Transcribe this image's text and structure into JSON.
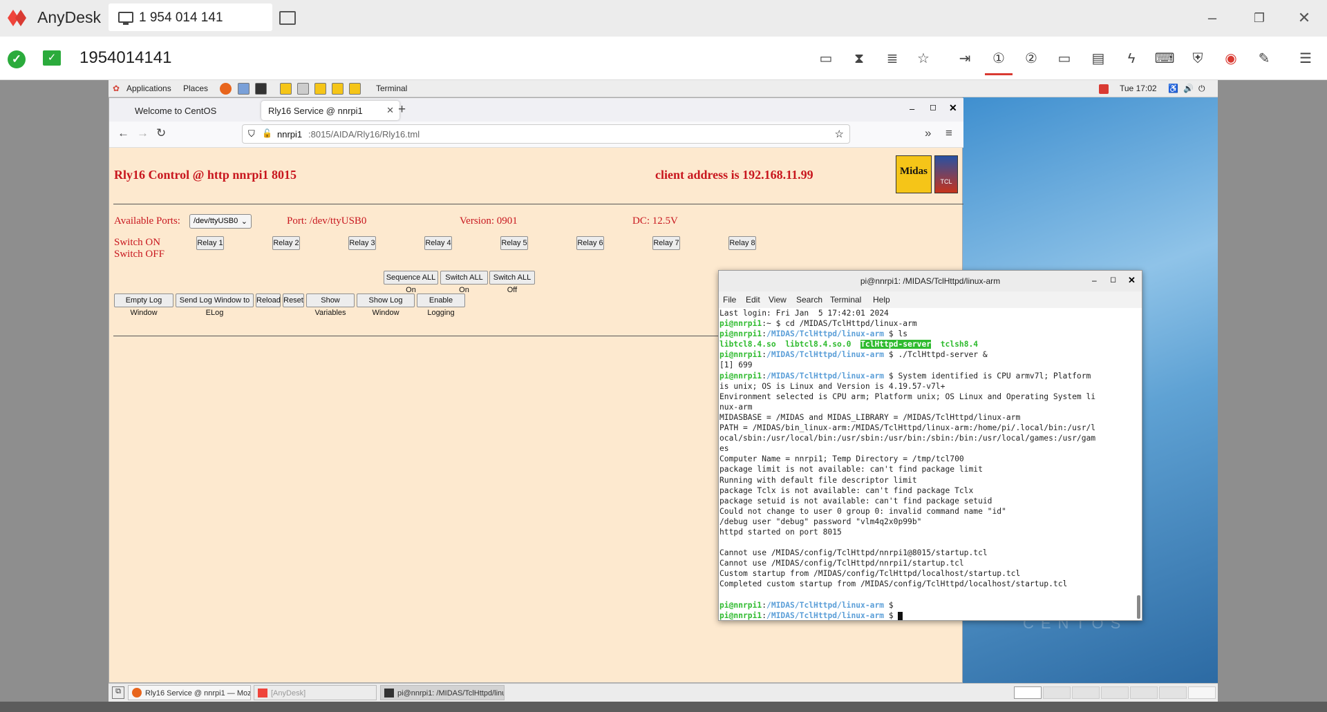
{
  "anydesk": {
    "brand": "AnyDesk",
    "tab_label": "1 954 014 141",
    "remote_id": "1954014141"
  },
  "gnome": {
    "applications": "Applications",
    "places": "Places",
    "terminal": "Terminal",
    "clock": "Tue 17:02"
  },
  "firefox": {
    "tab1": "Welcome to CentOS",
    "tab2": "Rly16 Service @ nnrpi1",
    "url_host": "nnrpi1",
    "url_path": ":8015/AIDA/Rly16/Rly16.tml"
  },
  "page": {
    "title": "Rly16 Control @ http nnrpi1 8015",
    "client": "client address is 192.168.11.99",
    "logo1_text": "Midas",
    "logo2_text": "TCL",
    "available_ports_label": "Available Ports:",
    "port_select": "/dev/ttyUSB0",
    "port": "Port: /dev/ttyUSB0",
    "version": "Version: 0901",
    "dc": "DC: 12.5V",
    "switch_on": "Switch ON",
    "switch_off": "Switch OFF",
    "relays": [
      "Relay 1",
      "Relay 2",
      "Relay 3",
      "Relay 4",
      "Relay 5",
      "Relay 6",
      "Relay 7",
      "Relay 8"
    ],
    "sequence_all_on": "Sequence ALL On",
    "switch_all_on": "Switch ALL On",
    "switch_all_off": "Switch ALL Off",
    "log_buttons": [
      "Empty Log Window",
      "Send Log Window to ELog",
      "Reload",
      "Reset",
      "Show Variables",
      "Show Log Window",
      "Enable Logging"
    ]
  },
  "terminal": {
    "title": "pi@nnrpi1: /MIDAS/TclHttpd/linux-arm",
    "menu": [
      "File",
      "Edit",
      "View",
      "Search",
      "Terminal",
      "Help"
    ],
    "prompt_user": "pi@nnrpi1",
    "prompt_path": "/MIDAS/TclHttpd/linux-arm",
    "line_login": "Last login: Fri Jan  5 17:42:01 2024",
    "cmd_cd": "cd /MIDAS/TclHttpd/linux-arm",
    "cmd_ls": "ls",
    "ls_1": "libtcl8.4.so",
    "ls_2": "libtcl8.4.so.0",
    "ls_3": "TclHttpd-server",
    "ls_4": "tclsh8.4",
    "cmd_run": "./TclHttpd-server &",
    "job": "[1] 699",
    "sys_1": "System identified is CPU armv7l; Platform",
    "out_lines": [
      "is unix; OS is Linux and Version is 4.19.57-v7l+",
      "Environment selected is CPU arm; Platform unix; OS Linux and Operating System li",
      "nux-arm",
      "MIDASBASE = /MIDAS and MIDAS_LIBRARY = /MIDAS/TclHttpd/linux-arm",
      "PATH = /MIDAS/bin_linux-arm:/MIDAS/TclHttpd/linux-arm:/home/pi/.local/bin:/usr/l",
      "ocal/sbin:/usr/local/bin:/usr/sbin:/usr/bin:/sbin:/bin:/usr/local/games:/usr/gam",
      "es",
      "Computer Name = nnrpi1; Temp Directory = /tmp/tcl700",
      "package limit is not available: can't find package limit",
      "Running with default file descriptor limit",
      "package Tclx is not available: can't find package Tclx",
      "package setuid is not available: can't find package setuid",
      "Could not change to user 0 group 0: invalid command name \"id\"",
      "/debug user \"debug\" password \"vlm4q2x0p99b\"",
      "httpd started on port 8015",
      "",
      "Cannot use /MIDAS/config/TclHttpd/nnrpi1@8015/startup.tcl",
      "Cannot use /MIDAS/config/TclHttpd/nnrpi1/startup.tcl",
      "Custom startup from /MIDAS/config/TclHttpd/localhost/startup.tcl",
      "Completed custom startup from /MIDAS/config/TclHttpd/localhost/startup.tcl",
      ""
    ],
    "centos_wm": "CENTOS"
  },
  "taskbar": {
    "task1": "Rly16 Service @ nnrpi1 — Mozilla Fi...",
    "task2": "[AnyDesk]",
    "task3": "pi@nnrpi1: /MIDAS/TclHttpd/linux-a..."
  },
  "colors": {
    "anydesk_red": "#d93a32",
    "page_bg": "#fde9cf",
    "page_text": "#c8161e",
    "prompt_green": "#2fbb2f",
    "prompt_blue": "#5c9fd8"
  }
}
